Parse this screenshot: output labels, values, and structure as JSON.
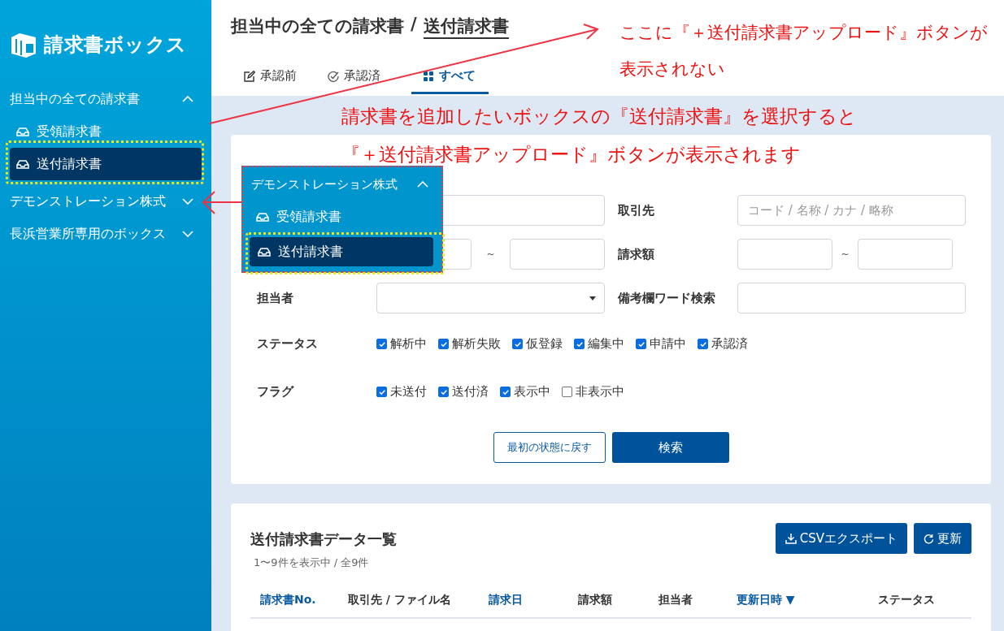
{
  "sidebar": {
    "logo": "請求書ボックス",
    "groups": [
      {
        "label": "担当中の全ての請求書",
        "expanded": true,
        "children": [
          {
            "label": "受領請求書",
            "selected": false
          },
          {
            "label": "送付請求書",
            "selected": true
          }
        ]
      },
      {
        "label": "デモンストレーション株式",
        "expanded": false
      },
      {
        "label": "長浜営業所専用のボックス",
        "expanded": false
      }
    ]
  },
  "header": {
    "breadcrumb": "担当中の全ての請求書",
    "separator": "/",
    "current": "送付請求書"
  },
  "tabs": [
    {
      "label": "承認前",
      "selected": false
    },
    {
      "label": "承認済",
      "selected": false
    },
    {
      "label": "すべて",
      "selected": true
    }
  ],
  "search_form": {
    "partner": {
      "label": "取引先",
      "placeholder": "コード / 名称 / カナ / 略称"
    },
    "range_separator": "~",
    "amount": {
      "label": "請求額"
    },
    "owner": {
      "label": "担当者"
    },
    "memo": {
      "label": "備考欄ワード検索"
    },
    "status": {
      "label": "ステータス",
      "options": [
        {
          "label": "解析中",
          "checked": true
        },
        {
          "label": "解析失敗",
          "checked": true
        },
        {
          "label": "仮登録",
          "checked": true
        },
        {
          "label": "編集中",
          "checked": true
        },
        {
          "label": "申請中",
          "checked": true
        },
        {
          "label": "承認済",
          "checked": true
        }
      ]
    },
    "flags": {
      "label": "フラグ",
      "options": [
        {
          "label": "未送付",
          "checked": true
        },
        {
          "label": "送付済",
          "checked": true
        },
        {
          "label": "表示中",
          "checked": true
        },
        {
          "label": "非表示中",
          "checked": false
        }
      ]
    },
    "reset_button": "最初の状態に戻す",
    "search_button": "検索"
  },
  "popup": {
    "title": "デモンストレーション株式",
    "expanded": true,
    "items": [
      {
        "label": "受領請求書",
        "selected": false
      },
      {
        "label": "送付請求書",
        "selected": true
      }
    ]
  },
  "list": {
    "title": "送付請求書データ一覧",
    "count": "1〜9件を表示中 / 全9件",
    "export_button": "CSVエクスポート",
    "refresh_button": "更新",
    "columns": [
      {
        "label": "請求書No.",
        "sortable": true
      },
      {
        "label": "取引先 / ファイル名",
        "sortable": false
      },
      {
        "label": "請求日",
        "sortable": true
      },
      {
        "label": "請求額",
        "sortable": false
      },
      {
        "label": "担当者",
        "sortable": false
      },
      {
        "label": "更新日時 ▼",
        "sortable": true
      },
      {
        "label": "ステータス",
        "sortable": false
      }
    ]
  },
  "annotations": {
    "top_note": "ここに『＋送付請求書アップロード』ボタンが表示されない",
    "middle_note": [
      "請求書を追加したいボックスの『送付請求書』を選択すると",
      "『＋送付請求書アップロード』ボタンが表示されます"
    ]
  }
}
